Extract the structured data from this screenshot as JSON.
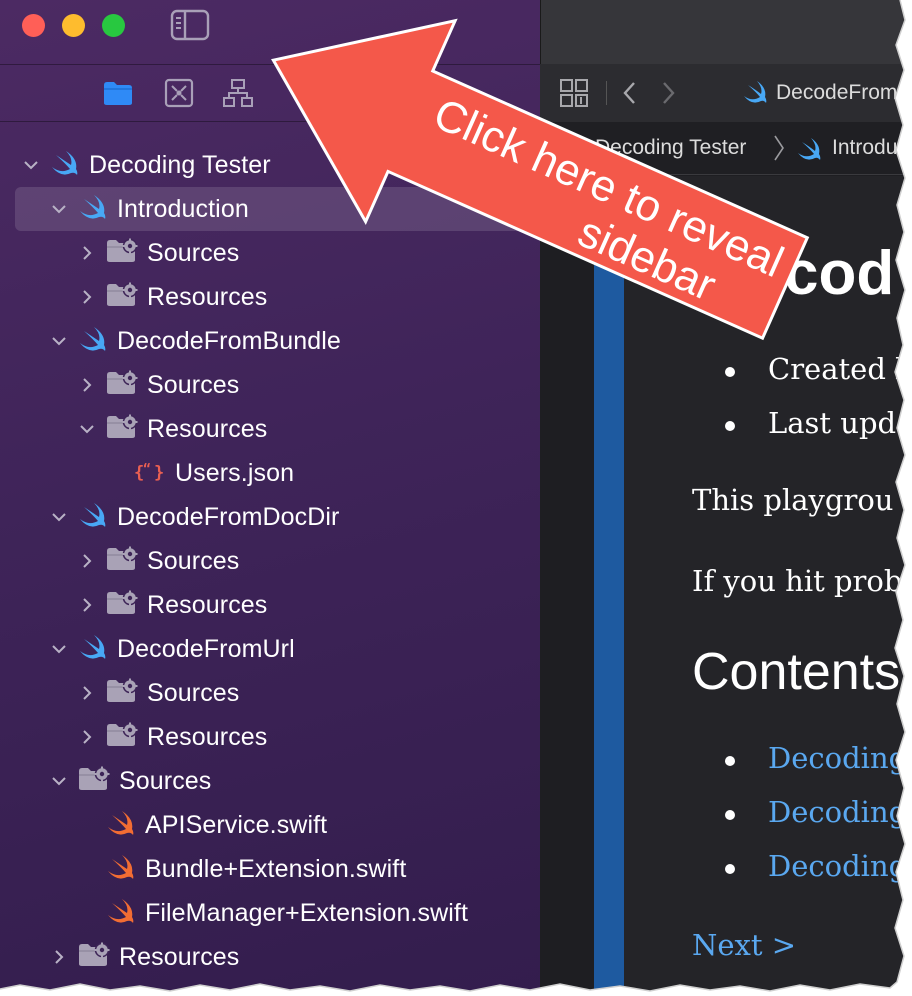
{
  "sidebar": {
    "tree": [
      {
        "label": "Decoding Tester",
        "level": 0,
        "icon": "swift-blue-icon",
        "expanded": true
      },
      {
        "label": "Introduction",
        "level": 1,
        "icon": "swift-blue-icon",
        "expanded": true,
        "selected": true
      },
      {
        "label": "Sources",
        "level": 2,
        "icon": "folder-gear-icon",
        "expanded": false
      },
      {
        "label": "Resources",
        "level": 2,
        "icon": "folder-gear-icon",
        "expanded": false
      },
      {
        "label": "DecodeFromBundle",
        "level": 1,
        "icon": "swift-blue-icon",
        "expanded": true
      },
      {
        "label": "Sources",
        "level": 2,
        "icon": "folder-gear-icon",
        "expanded": false
      },
      {
        "label": "Resources",
        "level": 2,
        "icon": "folder-gear-icon",
        "expanded": true
      },
      {
        "label": "Users.json",
        "level": 3,
        "icon": "json-file-icon"
      },
      {
        "label": "DecodeFromDocDir",
        "level": 1,
        "icon": "swift-blue-icon",
        "expanded": true
      },
      {
        "label": "Sources",
        "level": 2,
        "icon": "folder-gear-icon",
        "expanded": false
      },
      {
        "label": "Resources",
        "level": 2,
        "icon": "folder-gear-icon",
        "expanded": false
      },
      {
        "label": "DecodeFromUrl",
        "level": 1,
        "icon": "swift-blue-icon",
        "expanded": true
      },
      {
        "label": "Sources",
        "level": 2,
        "icon": "folder-gear-icon",
        "expanded": false
      },
      {
        "label": "Resources",
        "level": 2,
        "icon": "folder-gear-icon",
        "expanded": false
      },
      {
        "label": "Sources",
        "level": 1,
        "icon": "folder-gear-icon",
        "expanded": true
      },
      {
        "label": "APIService.swift",
        "level": 2,
        "icon": "swift-orange-icon"
      },
      {
        "label": "Bundle+Extension.swift",
        "level": 2,
        "icon": "swift-orange-icon"
      },
      {
        "label": "FileManager+Extension.swift",
        "level": 2,
        "icon": "swift-orange-icon"
      },
      {
        "label": "Resources",
        "level": 1,
        "icon": "folder-gear-icon",
        "expanded": false
      }
    ]
  },
  "editor": {
    "tab_title": "DecodeFrom",
    "breadcrumb_1": "Decoding Tester",
    "breadcrumb_2": "Introdu",
    "doc_heading": "cod",
    "bullet_1": "Created b",
    "bullet_2": "Last upda",
    "para_1": "This playgrou",
    "para_2": "If you hit probl",
    "contents_heading": "Contents",
    "link_1": "Decoding",
    "link_2": "Decoding",
    "link_3": "Decoding",
    "next_link": "Next >"
  },
  "annotation": {
    "line_1": "Click here to reveal",
    "line_2": "sidebar"
  },
  "colors": {
    "sidebar_top": "#4c2a63",
    "sidebar_bottom": "#331d4d",
    "annotation_fill": "#f4584a",
    "link_blue": "#5aa8f0",
    "swift_blue": "#48a8f5",
    "swift_orange": "#f26d33"
  }
}
